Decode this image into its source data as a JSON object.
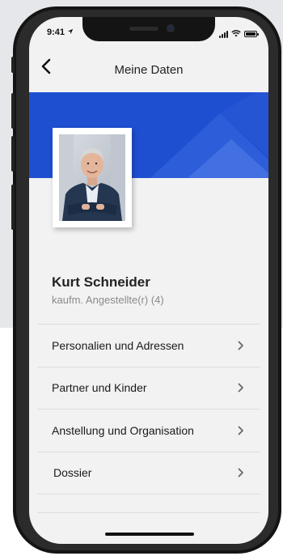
{
  "status_bar": {
    "time": "9:41",
    "icons": [
      "location-arrow-icon",
      "signal-icon",
      "wifi-icon",
      "battery-icon"
    ]
  },
  "header": {
    "title": "Meine Daten",
    "back_icon": "chevron-left-icon"
  },
  "banner": {
    "color": "#1f4fd1"
  },
  "profile": {
    "name": "Kurt Schneider",
    "role": "kaufm. Angestellte(r) (4)"
  },
  "menu": {
    "items": [
      {
        "label": "Personalien und Adressen",
        "icon": "chevron-right-icon"
      },
      {
        "label": "Partner und Kinder",
        "icon": "chevron-right-icon"
      },
      {
        "label": "Anstellung und Organisation",
        "icon": "chevron-right-icon"
      },
      {
        "label": "Dossier",
        "icon": "chevron-right-icon"
      }
    ]
  },
  "colors": {
    "accent": "#1f4fd1",
    "background": "#f2f2f2",
    "divider": "#dcdcdc"
  }
}
